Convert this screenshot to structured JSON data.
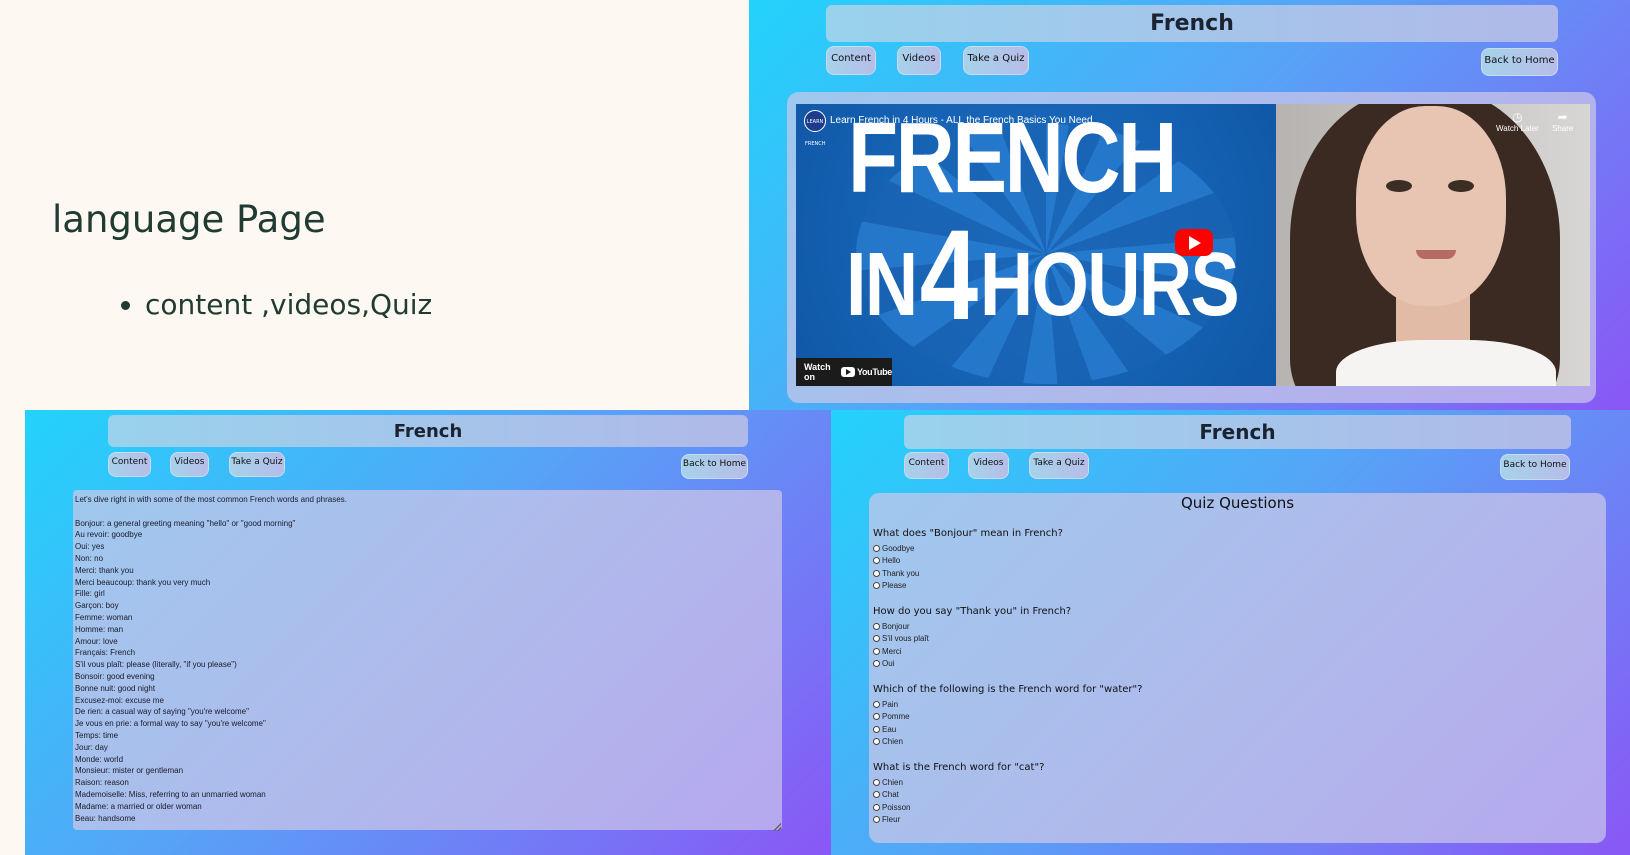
{
  "slide": {
    "title": "language Page",
    "bullet": "content ,videos,Quiz"
  },
  "app": {
    "header_title": "French",
    "nav": {
      "content": "Content",
      "videos": "Videos",
      "quiz": "Take a Quiz"
    },
    "back_home": "Back to Home"
  },
  "video": {
    "title": "Learn French in 4 Hours - ALL the French Basics You Need",
    "channel_badge": "LEARN FRENCH",
    "watch_later": "Watch Later",
    "share": "Share",
    "watch_on": "Watch on",
    "youtube": "YouTube",
    "thumb_line1": "FRENCH",
    "thumb_in": "IN",
    "thumb_num": "4",
    "thumb_hours": "HOURS"
  },
  "content": {
    "lines": [
      "Let's dive right in with some of the most common French words and phrases.",
      "",
      "Bonjour: a general greeting meaning \"hello\" or \"good morning\"",
      "Au revoir: goodbye",
      "Oui: yes",
      "Non: no",
      "Merci: thank you",
      "Merci beaucoup: thank you very much",
      "Fille: girl",
      "Garçon: boy",
      "Femme: woman",
      "Homme: man",
      "Amour: love",
      "Français: French",
      "S'il vous plaît: please (literally, \"if you please\")",
      "Bonsoir: good evening",
      "Bonne nuit: good night",
      "Excusez-moi: excuse me",
      "De rien: a casual way of saying \"you're welcome\"",
      "Je vous en prie: a formal way to say \"you're welcome\"",
      "Temps: time",
      "Jour: day",
      "Monde: world",
      "Monsieur: mister or gentleman",
      "Raison: reason",
      "Mademoiselle: Miss, referring to an unmarried woman",
      "Madame: a married or older woman",
      "Beau: handsome"
    ]
  },
  "quiz": {
    "title": "Quiz Questions",
    "questions": [
      {
        "q": "What does \"Bonjour\" mean in French?",
        "options": [
          "Goodbye",
          "Hello",
          "Thank you",
          "Please"
        ]
      },
      {
        "q": "How do you say \"Thank you\" in French?",
        "options": [
          "Bonjour",
          "S'il vous plaît",
          "Merci",
          "Oui"
        ]
      },
      {
        "q": "Which of the following is the French word for \"water\"?",
        "options": [
          "Pain",
          "Pomme",
          "Eau",
          "Chien"
        ]
      },
      {
        "q": "What is the French word for \"cat\"?",
        "options": [
          "Chien",
          "Chat",
          "Poisson",
          "Fleur"
        ]
      }
    ]
  },
  "colors": {
    "panel_gradient_start": "#22d3fb",
    "panel_gradient_end": "#8a57f5",
    "slide_bg": "#fdf8f1",
    "slide_text": "#1f3b32",
    "youtube_red": "#ff0000"
  },
  "icons": {
    "watch_later": "clock-icon",
    "share": "share-icon",
    "play": "youtube-play-icon"
  }
}
